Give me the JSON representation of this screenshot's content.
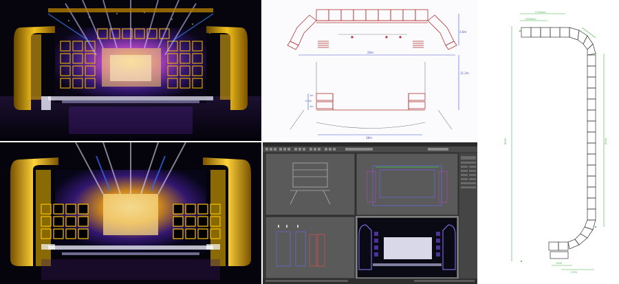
{
  "collage": {
    "render_top": {
      "label": ""
    },
    "render_bottom": {
      "label": ""
    },
    "plan": {
      "dims": {
        "right_top": "3.6m",
        "width_mid": "20m",
        "right_side": "11.2m",
        "small_top": "1m",
        "small_mid": "0.5m",
        "small_bot": "1m",
        "bottom_width": "18m"
      }
    },
    "max_viewport": {
      "menu_items": [
        "File",
        "Edit",
        "Tools",
        "Group",
        "Views",
        "Create",
        "Modifiers",
        "Animation",
        "Graph Editors",
        "Rendering",
        "Customize",
        "MAXScript",
        "Help"
      ],
      "status": "Click or click-and-drag to select objects"
    },
    "elevation": {
      "dims": {
        "top_a": "2750mm",
        "top_b": "2000mm",
        "left_height": "8500",
        "right_height": "6500",
        "bottom_a": "1000",
        "bottom_b": "2750"
      }
    }
  },
  "colors": {
    "gold": "#d6a000",
    "purple": "#6a2bbf",
    "dark": "#06050e",
    "cad_red": "#b03030",
    "cad_blue": "#4050c0",
    "cad_green": "#40b040",
    "max_bg": "#3b3b3b"
  }
}
